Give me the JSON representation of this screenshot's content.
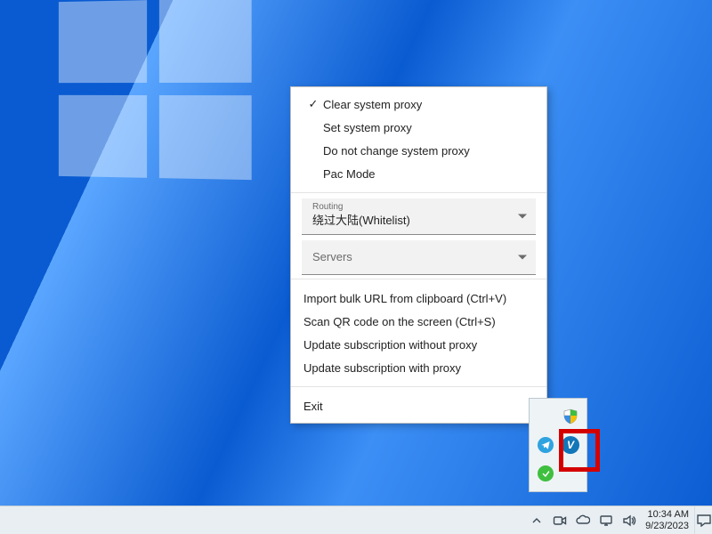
{
  "menu": {
    "proxy": {
      "clear": {
        "label": "Clear system proxy",
        "checked": true
      },
      "set": {
        "label": "Set system proxy",
        "checked": false
      },
      "noop": {
        "label": "Do not change system proxy",
        "checked": false
      },
      "pac": {
        "label": "Pac Mode",
        "checked": false
      }
    },
    "routing": {
      "hint": "Routing",
      "value": "绕过大陆(Whitelist)"
    },
    "servers": {
      "value": "Servers"
    },
    "actions": {
      "import_url": "Import bulk URL from clipboard (Ctrl+V)",
      "scan_qr": "Scan QR code on the screen (Ctrl+S)",
      "update_np": "Update subscription without proxy",
      "update_p": "Update subscription with proxy"
    },
    "exit": "Exit"
  },
  "tray_overflow": {
    "security_icon": "windows-security-shield",
    "telegram_icon": "telegram",
    "v2ray_icon": "v2rayN",
    "status_icon": "online"
  },
  "systray": {
    "time": "10:34 AM",
    "date": "9/23/2023"
  }
}
